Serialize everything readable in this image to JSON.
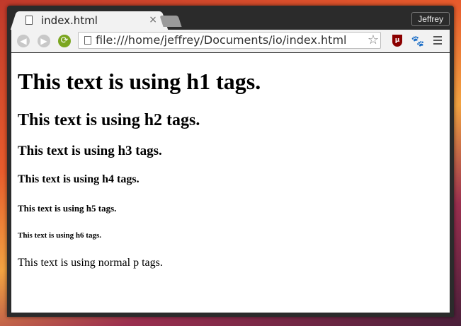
{
  "browser": {
    "tab_title": "index.html",
    "tab_close": "×",
    "profile_name": "Jeffrey",
    "url": "file:///home/jeffrey/Documents/io/index.html",
    "back_icon": "◀",
    "forward_icon": "▶",
    "reload_icon": "⟳",
    "star_icon": "☆",
    "ext_ublock_label": "μ",
    "ext_2_icon": "🐾"
  },
  "page": {
    "h1": "This text is using h1 tags.",
    "h2": "This text is using h2 tags.",
    "h3": "This text is using h3 tags.",
    "h4": "This text is using h4 tags.",
    "h5": "This text is using h5 tags.",
    "h6": "This text is using h6 tags.",
    "p": "This text is using normal p tags."
  },
  "colors": {
    "accent_reload": "#7ba620",
    "ublock": "#8b0000",
    "window_frame": "#2b2b2b"
  }
}
